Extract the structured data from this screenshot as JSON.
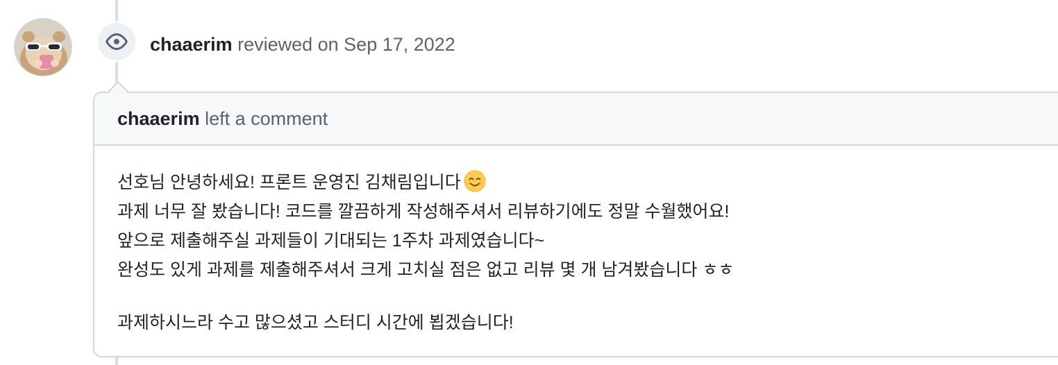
{
  "timeline_event": {
    "author": "chaaerim",
    "action": "reviewed on Sep 17, 2022",
    "icon": "eye-icon"
  },
  "avatar": {
    "icon": "hamster-with-sunglasses-avatar"
  },
  "comment": {
    "author": "chaaerim",
    "header_action": "left a comment",
    "lines": [
      "선호님 안녕하세요! 프론트 운영진 김채림입니다",
      "과제 너무 잘 봤습니다! 코드를 깔끔하게 작성해주셔서 리뷰하기에도 정말 수월했어요!",
      "앞으로 제출해주실 과제들이 기대되는 1주차 과제였습니다~",
      "완성도 있게 과제를 제출해주셔서 크게 고치실 점은 없고 리뷰 몇 개 남겨봤습니다 ㅎㅎ",
      "과제하시느라 수고 많으셨고 스터디 시간에 뵙겠습니다!"
    ],
    "emoji_icon": "smiling-face-emoji"
  },
  "colors": {
    "border": "#d0d7de",
    "header_bg": "#f6f8fa",
    "muted_text": "#59636e",
    "text": "#1f2328",
    "badge_bg": "#eef1f4"
  }
}
